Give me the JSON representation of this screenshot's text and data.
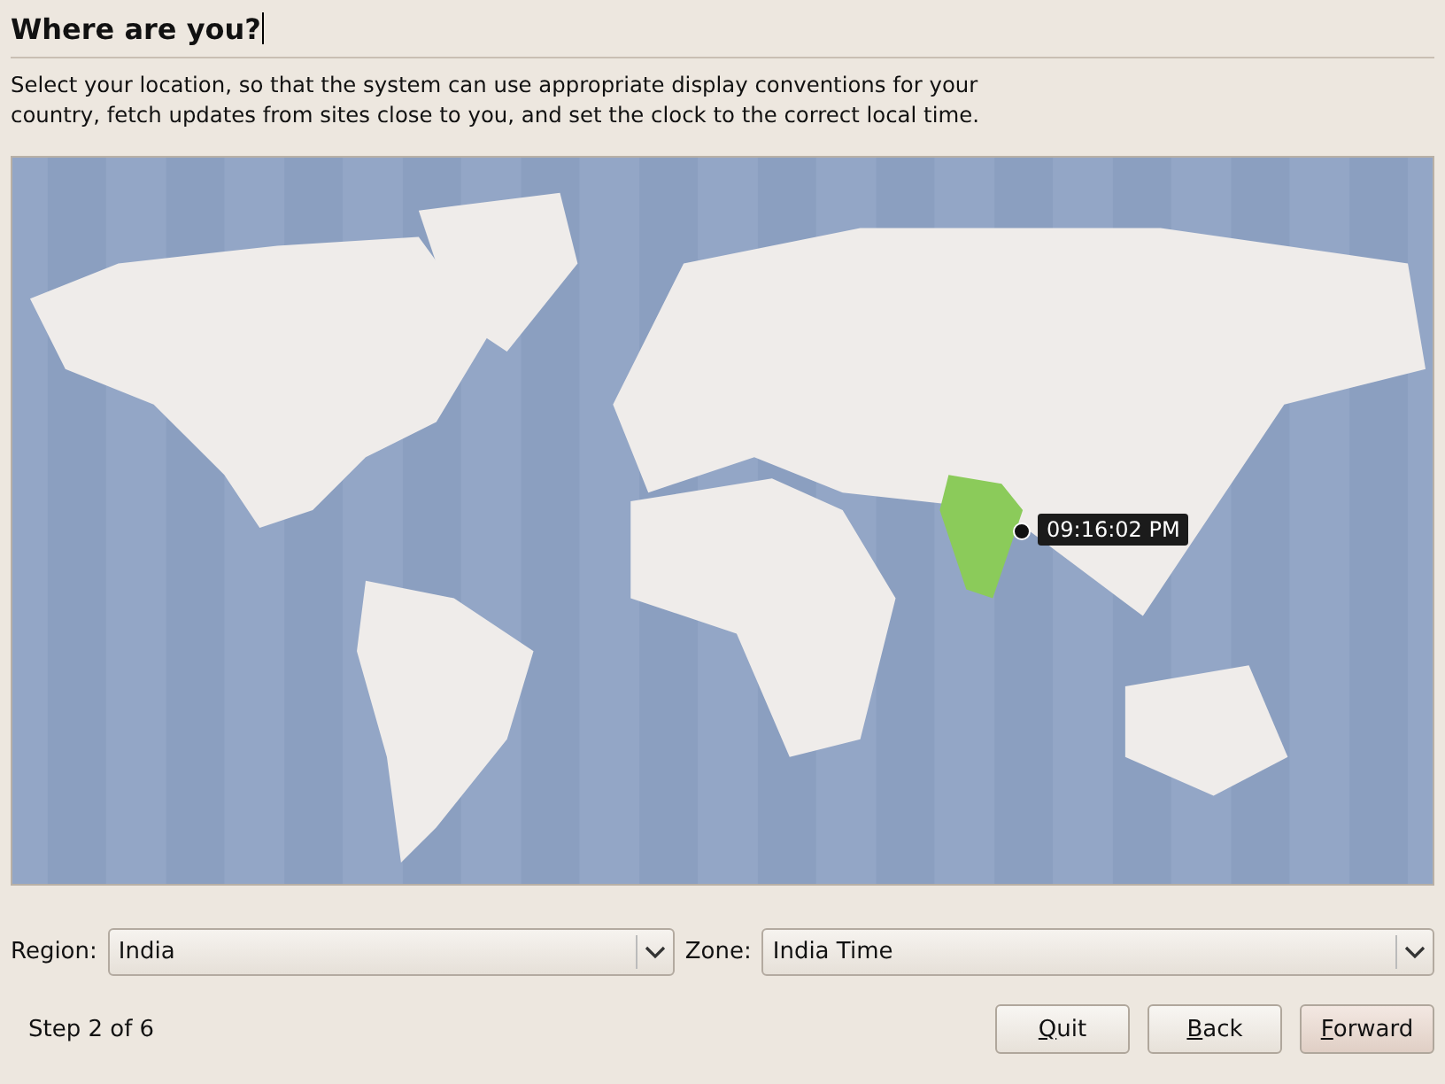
{
  "title": "Where are you?",
  "description": "Select your location, so that the system can use appropriate display conventions for your country, fetch updates from sites close to you, and set the clock to the correct local time.",
  "map": {
    "kind": "picture",
    "tooltip": "09:16:02 PM"
  },
  "region": {
    "label": "Region:",
    "value": "India"
  },
  "zone": {
    "label": "Zone:",
    "value": "India Time"
  },
  "status": "Step 2 of 6",
  "buttons": [
    {
      "label": "Quit",
      "kind": "normal"
    },
    {
      "label": "Back",
      "kind": "normal"
    },
    {
      "label": "Forward",
      "kind": "default"
    }
  ]
}
